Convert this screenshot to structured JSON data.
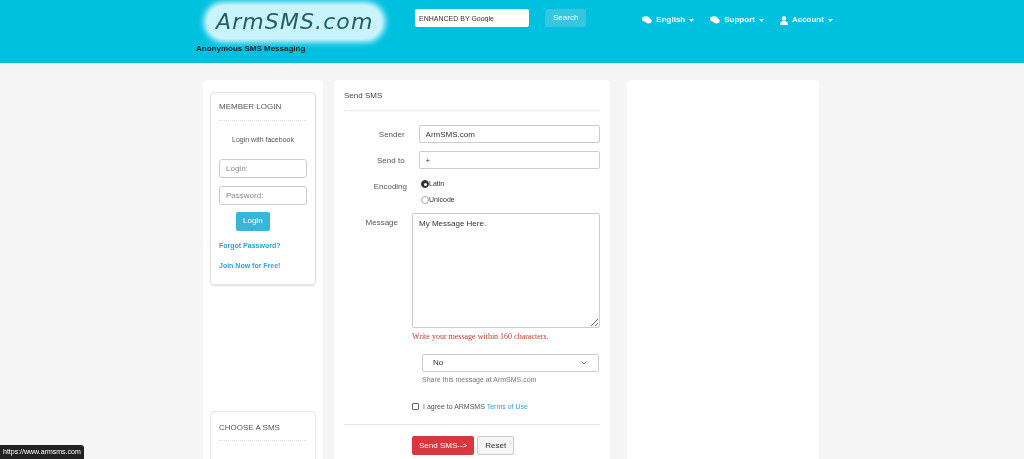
{
  "header": {
    "logo": "ArmSMS.com",
    "tagline": "Anonymous SMS Messaging",
    "search": {
      "placeholder": "ENHANCED BY Google",
      "button": "Search"
    },
    "nav": [
      {
        "label": "English",
        "kind": "chat"
      },
      {
        "label": "Support",
        "kind": "chat"
      },
      {
        "label": "Account",
        "kind": "user"
      }
    ]
  },
  "login": {
    "title": "MEMBER LOGIN",
    "facebook": "Login with facebook",
    "fields": [
      {
        "placeholder": "Login:"
      },
      {
        "placeholder": "Password:"
      }
    ],
    "button": "Login",
    "links": [
      "Forgot Password?",
      "Join Now for Free!"
    ]
  },
  "choose": {
    "title": "CHOOSE A SMS"
  },
  "form": {
    "title": "Send SMS",
    "sender_label": "Sender",
    "sender": "ArmSMS.com",
    "sendto_label": "Send to",
    "sendto": "+",
    "encoding_label": "Encoding",
    "encodings": [
      {
        "label": "Latin",
        "selected": true
      },
      {
        "label": "Unicode",
        "selected": false
      }
    ],
    "message_label": "Message",
    "message": "My Message Here.",
    "warning": "Write your message within 160 characters.",
    "share": {
      "value": "No",
      "hint": "Share this message at ArmSMS.com"
    },
    "agree": {
      "checked": false,
      "text": "I agree to ARMSMS ",
      "link": "Terms of Use"
    },
    "buttons": [
      {
        "label": "Send SMS-->",
        "kind": "primary"
      },
      {
        "label": "Reset",
        "kind": "default"
      }
    ]
  },
  "status_bar": "https://www.armsms.com"
}
